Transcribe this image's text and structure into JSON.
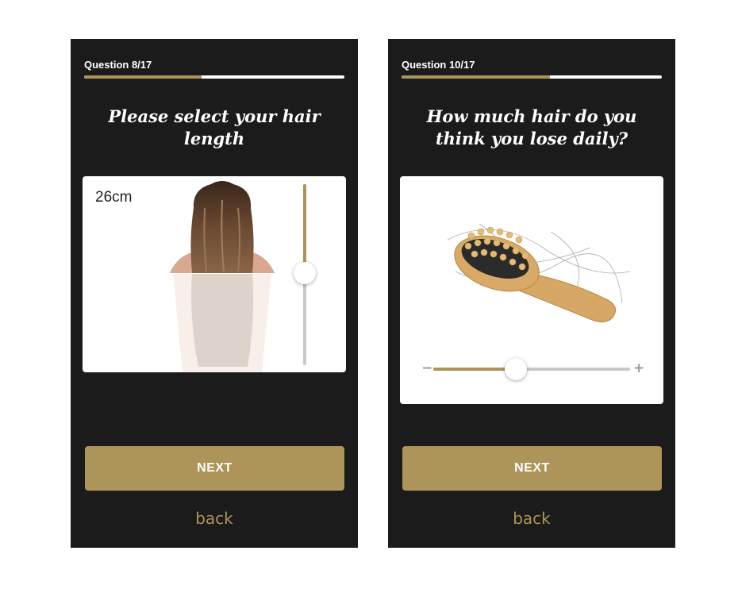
{
  "colors": {
    "background": "#1c1b1b",
    "accent": "#ad9458",
    "track": "#c8c8c8",
    "text": "#ffffff"
  },
  "screens": [
    {
      "question_label": "Question 8/17",
      "progress": 0.45,
      "title": "Please select your hair length",
      "measurement": "26cm",
      "slider_value": 0.49,
      "next_label": "NEXT",
      "back_label": "back",
      "illustration": "hair-length-figure"
    },
    {
      "question_label": "Question 10/17",
      "progress": 0.57,
      "title": "How much hair do you think you lose daily?",
      "slider_value": 0.42,
      "minus_icon": "minus-icon",
      "plus_icon": "plus-icon",
      "next_label": "NEXT",
      "back_label": "back",
      "illustration": "hairbrush-with-hair"
    }
  ]
}
